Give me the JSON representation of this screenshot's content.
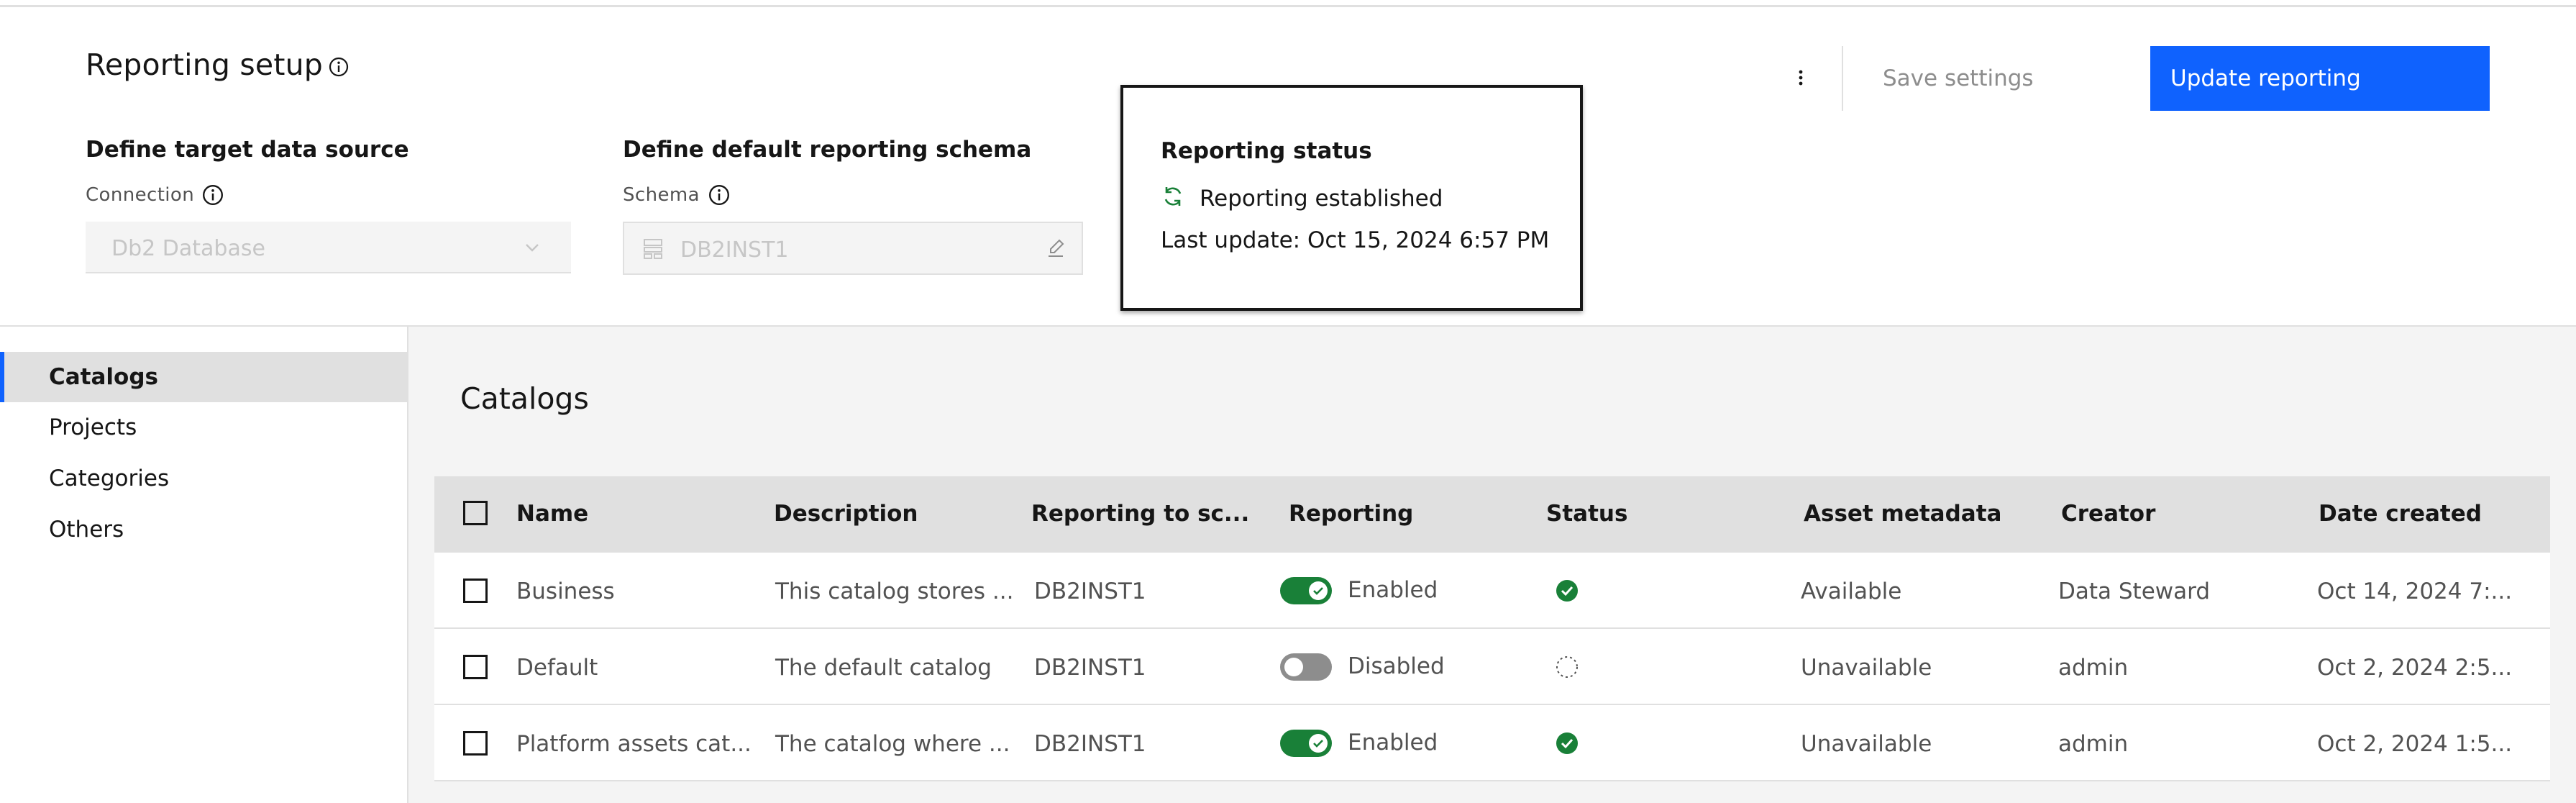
{
  "header": {
    "title": "Reporting setup",
    "kebab_icon": "overflow-menu-icon",
    "save_label": "Save settings",
    "update_label": "Update reporting"
  },
  "target": {
    "heading": "Define target data source",
    "connection_label": "Connection",
    "connection_value": "Db2 Database"
  },
  "schema": {
    "heading": "Define default reporting schema",
    "schema_label": "Schema",
    "schema_value": "DB2INST1"
  },
  "status": {
    "heading": "Reporting status",
    "state": "Reporting established",
    "last_update": "Last update: Oct 15, 2024 6:57 PM"
  },
  "sidebar": {
    "items": [
      {
        "label": "Catalogs",
        "active": true
      },
      {
        "label": "Projects",
        "active": false
      },
      {
        "label": "Categories",
        "active": false
      },
      {
        "label": "Others",
        "active": false
      }
    ]
  },
  "main": {
    "title": "Catalogs",
    "columns": [
      "Name",
      "Description",
      "Reporting to sc...",
      "Reporting",
      "Status",
      "Asset metadata",
      "Creator",
      "Date created"
    ],
    "rows": [
      {
        "name": "Business",
        "description": "This catalog stores ...",
        "schema": "DB2INST1",
        "reporting": "Enabled",
        "enabled": true,
        "status": "ok",
        "asset_metadata": "Available",
        "creator": "Data Steward",
        "date": "Oct 14, 2024 7:..."
      },
      {
        "name": "Default",
        "description": "The default catalog",
        "schema": "DB2INST1",
        "reporting": "Disabled",
        "enabled": false,
        "status": "pending",
        "asset_metadata": "Unavailable",
        "creator": "admin",
        "date": "Oct 2, 2024 2:5..."
      },
      {
        "name": "Platform assets cat...",
        "description": "The catalog where ...",
        "schema": "DB2INST1",
        "reporting": "Enabled",
        "enabled": true,
        "status": "ok",
        "asset_metadata": "Unavailable",
        "creator": "admin",
        "date": "Oct 2, 2024 1:5..."
      }
    ]
  },
  "colors": {
    "primary": "#0f62fe",
    "success": "#198038",
    "toggle_off": "#8d8d8d"
  }
}
